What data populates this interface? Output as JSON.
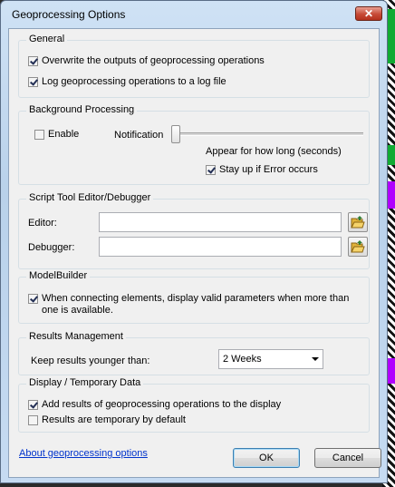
{
  "window": {
    "title": "Geoprocessing Options",
    "close_glyph": "✕"
  },
  "general": {
    "legend": "General",
    "overwrite_label": "Overwrite the outputs of geoprocessing operations",
    "overwrite_checked": true,
    "log_label": "Log geoprocessing operations to a log file",
    "log_checked": true
  },
  "background": {
    "legend": "Background Processing",
    "enable_label": "Enable",
    "enable_checked": false,
    "notification_label": "Notification",
    "slider_level": 0,
    "appear_label": "Appear for how long (seconds)",
    "stay_label": "Stay up if Error occurs",
    "stay_checked": true
  },
  "script_tool": {
    "legend": "Script Tool Editor/Debugger",
    "editor_label": "Editor:",
    "editor_value": "",
    "debugger_label": "Debugger:",
    "debugger_value": ""
  },
  "modelbuilder": {
    "legend": "ModelBuilder",
    "connect_label": "When connecting elements, display valid parameters when more than one is available.",
    "connect_checked": true
  },
  "results": {
    "legend": "Results Management",
    "keep_label": "Keep results younger than:",
    "keep_value": "2 Weeks"
  },
  "display": {
    "legend": "Display / Temporary Data",
    "add_label": "Add results of geoprocessing operations to the display",
    "add_checked": true,
    "temp_label": "Results are temporary by default",
    "temp_checked": false
  },
  "footer": {
    "about_link": "About geoprocessing options",
    "ok_label": "OK",
    "cancel_label": "Cancel"
  },
  "icons": {
    "folder": "open-folder-icon",
    "close": "close-icon",
    "dropdown": "chevron-down-icon"
  }
}
